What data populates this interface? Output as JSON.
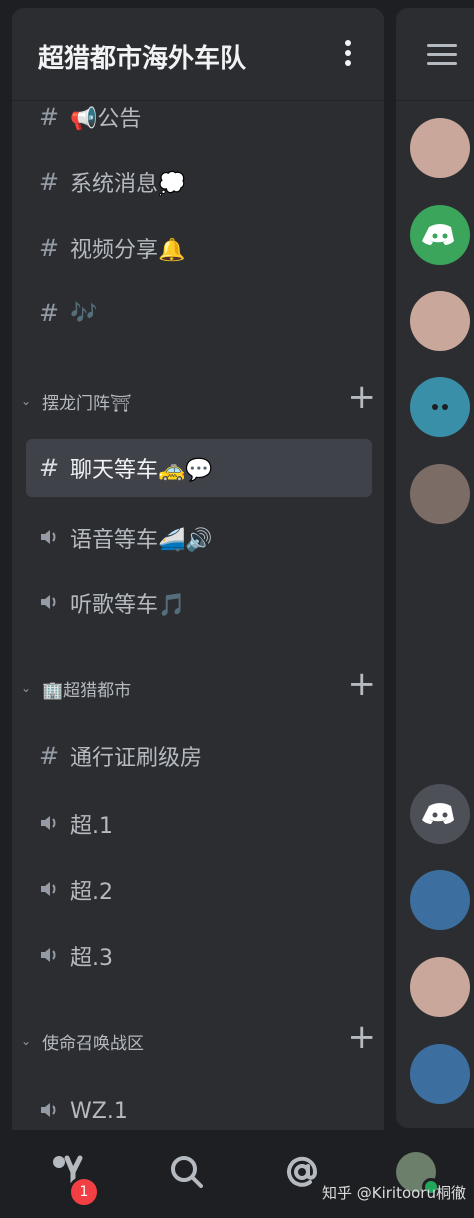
{
  "server": {
    "title": "超猎都市海外车队"
  },
  "channels": [
    {
      "type": "text",
      "label": "📢公告"
    },
    {
      "type": "text",
      "label": "系统消息💭"
    },
    {
      "type": "text",
      "label": "视频分享🔔"
    },
    {
      "type": "text",
      "label": "🎶"
    }
  ],
  "categories": [
    {
      "label": "摆龙门阵⛩",
      "channels": [
        {
          "type": "text",
          "label": "聊天等车🚕💬",
          "active": true
        },
        {
          "type": "voice",
          "label": "语音等车🚄🔊"
        },
        {
          "type": "voice",
          "label": "听歌等车🎵"
        }
      ]
    },
    {
      "label": "🏢超猎都市",
      "channels": [
        {
          "type": "text",
          "label": "通行证刷级房"
        },
        {
          "type": "voice",
          "label": "超.1"
        },
        {
          "type": "voice",
          "label": "超.2"
        },
        {
          "type": "voice",
          "label": "超.3"
        }
      ]
    },
    {
      "label": "使命召唤战区",
      "channels": [
        {
          "type": "voice",
          "label": "WZ.1"
        }
      ]
    }
  ],
  "symbols": {
    "text": "#",
    "chevron": "⌄",
    "plus": "+"
  },
  "members": [
    {
      "kind": "anime",
      "color": "#c9a79b"
    },
    {
      "kind": "discord",
      "color": "#3ba55c"
    },
    {
      "kind": "anime",
      "color": "#c9a79b"
    },
    {
      "kind": "face",
      "color": "#3a8fa8"
    },
    {
      "kind": "photo",
      "color": "#7c6c66"
    },
    {
      "kind": "discord",
      "color": "#4e5058"
    },
    {
      "kind": "art",
      "color": "#3c6fa0"
    },
    {
      "kind": "anime",
      "color": "#c9a79b"
    },
    {
      "kind": "art",
      "color": "#3c6fa0"
    }
  ],
  "bottom_nav": {
    "badge_count": "1",
    "watermark": "知乎 @Kiritooru桐徹"
  },
  "colors": {
    "background": "#1e1f22",
    "panel": "#2b2d31",
    "active_row": "#404249",
    "badge": "#f23f43",
    "online": "#23a55a"
  }
}
